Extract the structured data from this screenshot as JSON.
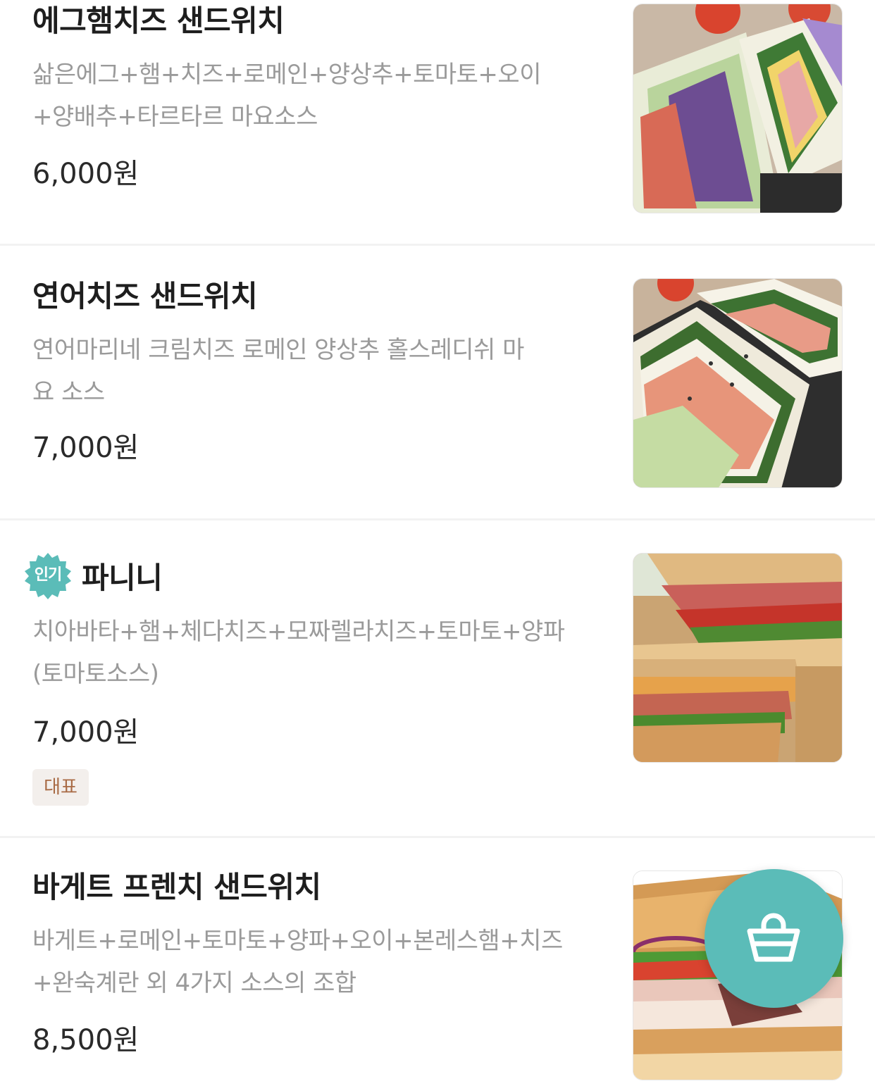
{
  "menu": {
    "items": [
      {
        "name": "에그햄치즈 샌드위치",
        "desc_line1": "삶은에그+햄+치즈+로메인+양상추+토마토+오이",
        "desc_line2": "+양배추+타르타르 마요소스",
        "price": "6,000원",
        "image_icon": "sandwich-photo"
      },
      {
        "name": "연어치즈 샌드위치",
        "desc_line1": "연어마리네 크림치즈 로메인 양상추 홀스레디쉬 마",
        "desc_line2": "요 소스",
        "price": "7,000원",
        "image_icon": "sandwich-photo"
      },
      {
        "name": "파니니",
        "badge": "인기",
        "desc_line1": "치아바타+햄+체다치즈+모짜렐라치즈+토마토+양파",
        "desc_line2": "(토마토소스)",
        "price": "7,000원",
        "tag": "대표",
        "image_icon": "panini-photo"
      },
      {
        "name": "바게트 프렌치 샌드위치",
        "desc_line1": "바게트+로메인+토마토+양파+오이+본레스햄+치즈",
        "desc_line2": "+완숙계란 외 4가지 소스의 조합",
        "price": "8,500원",
        "image_icon": "baguette-photo"
      }
    ]
  },
  "cart_button": {
    "icon": "shopping-basket-icon"
  },
  "colors": {
    "accent": "#5bbcb8",
    "tag_bg": "#f3efec",
    "tag_text": "#a86a44",
    "desc_text": "#9a9a9a"
  }
}
